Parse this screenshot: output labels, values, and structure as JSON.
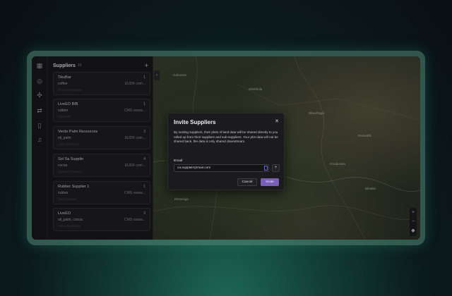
{
  "panel": {
    "title": "Suppliers",
    "count": "10",
    "add_icon": "plus-icon",
    "toggle_icon": "chevron-right-icon"
  },
  "rail": {
    "icons": [
      "map-icon",
      "globe-icon",
      "network-icon",
      "transfer-icon",
      "document-icon",
      "bell-icon"
    ]
  },
  "suppliers": [
    {
      "name": "TikuBar",
      "commodity": "coffee",
      "count": "1",
      "regulation": "EUDR com...",
      "sub": "Plot Landmapper"
    },
    {
      "name": "LiveEO BIB",
      "commodity": "rubber",
      "count": "1",
      "regulation": "CMS raswa...",
      "sub": "Aldonoth"
    },
    {
      "name": "Verde Palm Resources",
      "commodity": "oil_palm",
      "count": "3",
      "regulation": "EUDR com...",
      "sub": "Lium Vladmum"
    },
    {
      "name": "Sol Sa Supplie",
      "commodity": "cocoa",
      "count": "4",
      "regulation": "EUDR com...",
      "sub": "Gabian Schnoss"
    },
    {
      "name": "Rubber Supplier 1",
      "commodity": "rubber",
      "count": "1",
      "regulation": "CMS raswa...",
      "sub": "Tom Salama"
    },
    {
      "name": "LiveEO",
      "commodity": "oil_palm, cocoa",
      "count": "3",
      "regulation": "CMS raswa...",
      "sub": "Gaba Rumbrine"
    }
  ],
  "map": {
    "labels": [
      "Gohoreet",
      "Ghekhola",
      "Bhaorhagu",
      "Ranwahli",
      "Ritewalga",
      "Gruakasan",
      "Bihalari"
    ],
    "zoom_in": "+",
    "zoom_out": "−"
  },
  "modal": {
    "title": "Invite Suppliers",
    "close_icon": "close-icon",
    "description": "By inviting suppliers, their plots of land data will be shared directly to you rolled up from their suppliers and sub-suppliers. Your plot data will not be shared back, the data is only shared downstream.",
    "email_label": "Email",
    "email_value": "ca.supplier@mail.com",
    "add_label": "+",
    "cancel_label": "Cancel",
    "invite_label": "Invite"
  },
  "colors": {
    "accent": "#7a5fb8",
    "frame_glow": "#1d6a55"
  }
}
